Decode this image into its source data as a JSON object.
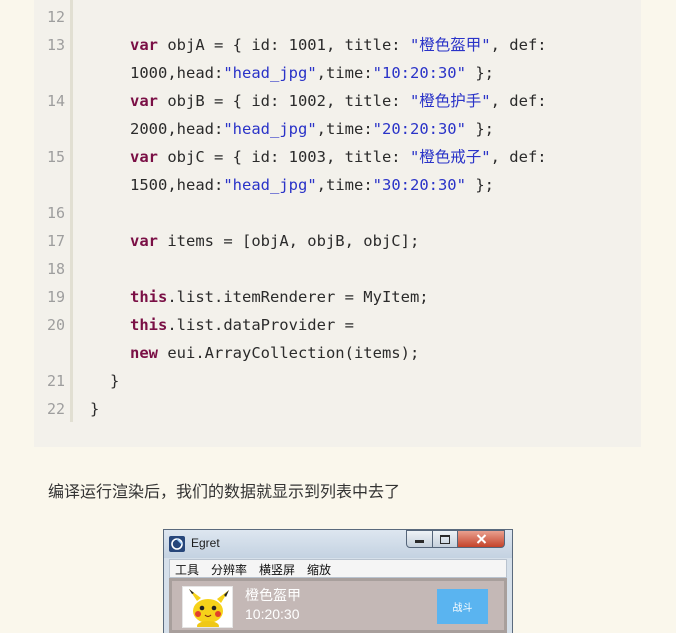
{
  "code": {
    "line_numbers": [
      "12",
      "13",
      "14",
      "15",
      "16",
      "17",
      "18",
      "19",
      "20",
      "21",
      "22"
    ],
    "lines": {
      "l13a": {
        "kw": "var",
        "pre": " objA = { id: 1001, title: ",
        "s1": "\"橙色盔甲\"",
        "post": ", def:"
      },
      "l13b": {
        "pre": "1000,head:",
        "s1": "\"head_jpg\"",
        "mid": ",time:",
        "s2": "\"10:20:30\"",
        "post": " };"
      },
      "l14a": {
        "kw": "var",
        "pre": " objB = { id: 1002, title: ",
        "s1": "\"橙色护手\"",
        "post": ", def:"
      },
      "l14b": {
        "pre": "2000,head:",
        "s1": "\"head_jpg\"",
        "mid": ",time:",
        "s2": "\"20:20:30\"",
        "post": " };"
      },
      "l15a": {
        "kw": "var",
        "pre": " objC = { id: 1003, title: ",
        "s1": "\"橙色戒子\"",
        "post": ", def:"
      },
      "l15b": {
        "pre": "1500,head:",
        "s1": "\"head_jpg\"",
        "mid": ",time:",
        "s2": "\"30:20:30\"",
        "post": " };"
      },
      "l17": {
        "kw": "var",
        "post": " items = [objA, objB, objC];"
      },
      "l19": {
        "kw": "this",
        "post": ".list.itemRenderer = MyItem;"
      },
      "l20a": {
        "kw": "this",
        "post": ".list.dataProvider ="
      },
      "l20b": {
        "kw": "new",
        "post": " eui.ArrayCollection(items);"
      },
      "l21": {
        "text": "}"
      },
      "l22": {
        "text": "}"
      }
    }
  },
  "caption": "编译运行渲染后，我们的数据就显示到列表中去了",
  "window": {
    "title": "Egret",
    "menu": [
      "工具",
      "分辨率",
      "横竖屏",
      "缩放"
    ],
    "item": {
      "title": "橙色盔甲",
      "time": "10:20:30",
      "button_label": "战斗"
    }
  },
  "colors": {
    "keyword": "#7a0f45",
    "string": "#2a33c8",
    "button": "#5ab4f0"
  }
}
